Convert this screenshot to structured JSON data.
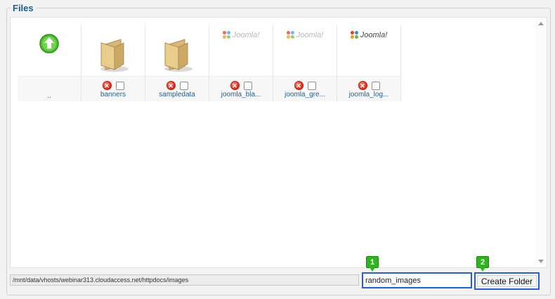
{
  "section": {
    "legend": "Files"
  },
  "items": [
    {
      "label": "..",
      "kind": "up",
      "icon": "up-arrow-icon"
    },
    {
      "label": "banners",
      "kind": "folder",
      "icon": "folder-icon"
    },
    {
      "label": "sampledata",
      "kind": "folder",
      "icon": "folder-icon"
    },
    {
      "label": "joomla_bla...",
      "kind": "image",
      "icon": "joomla-logo-icon"
    },
    {
      "label": "joomla_gre...",
      "kind": "image",
      "icon": "joomla-logo-icon"
    },
    {
      "label": "joomla_log...",
      "kind": "image",
      "icon": "joomla-logo-icon"
    }
  ],
  "logo_text": "Joomla!",
  "path": {
    "value": "/mnt/data/vhosts/webinar313.cloudaccess.net/httpdocs/images"
  },
  "folder_input": {
    "value": "random_images"
  },
  "create_button": {
    "label": "Create Folder"
  },
  "markers": {
    "one": "1",
    "two": "2"
  },
  "colors": {
    "legend": "#146295",
    "highlight": "#1f5fe6",
    "marker": "#2eb51e"
  }
}
